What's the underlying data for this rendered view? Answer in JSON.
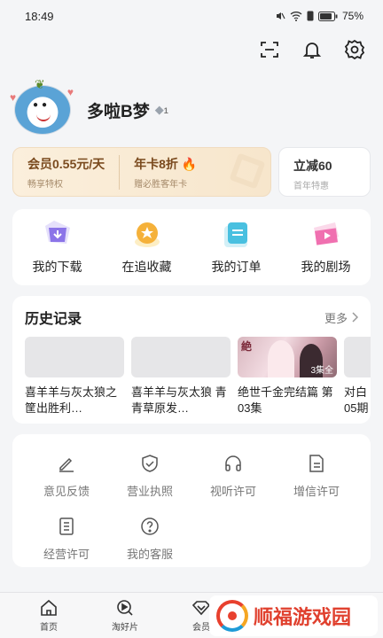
{
  "status": {
    "time": "18:49",
    "battery": "75%"
  },
  "profile": {
    "username": "多啦B梦",
    "level": "1"
  },
  "vip": {
    "member_price": "会员0.55元/天",
    "member_sub": "畅享特权",
    "year_card": "年卡8折",
    "year_card_sub": "赠必胜客年卡",
    "discount": "立减60",
    "discount_sub": "首年特惠"
  },
  "quick_actions": [
    {
      "label": "我的下载",
      "icon": "download-icon"
    },
    {
      "label": "在追收藏",
      "icon": "favorite-icon"
    },
    {
      "label": "我的订单",
      "icon": "order-icon"
    },
    {
      "label": "我的剧场",
      "icon": "theater-icon"
    }
  ],
  "history": {
    "title": "历史记录",
    "more": "更多",
    "items": [
      {
        "title": "喜羊羊与灰太狼之筐出胜利…"
      },
      {
        "title": "喜羊羊与灰太狼 青青草原发…"
      },
      {
        "title": "绝世千金完结篇 第03集",
        "episode": "3集全"
      },
      {
        "title": "对白05期"
      }
    ]
  },
  "services": [
    {
      "label": "意见反馈",
      "icon": "feedback-icon"
    },
    {
      "label": "营业执照",
      "icon": "license-icon"
    },
    {
      "label": "视听许可",
      "icon": "headphones-icon"
    },
    {
      "label": "增信许可",
      "icon": "document-icon"
    },
    {
      "label": "经营许可",
      "icon": "permit-icon"
    },
    {
      "label": "我的客服",
      "icon": "help-icon"
    }
  ],
  "tabbar": [
    {
      "label": "首页",
      "icon": "home-icon"
    },
    {
      "label": "淘好片",
      "icon": "discover-icon"
    },
    {
      "label": "会员",
      "icon": "vip-icon"
    }
  ],
  "watermark": {
    "text": "顺福游戏园"
  },
  "colors": {
    "accent_gold": "#7a4a1e",
    "brand_red": "#e0402e"
  }
}
